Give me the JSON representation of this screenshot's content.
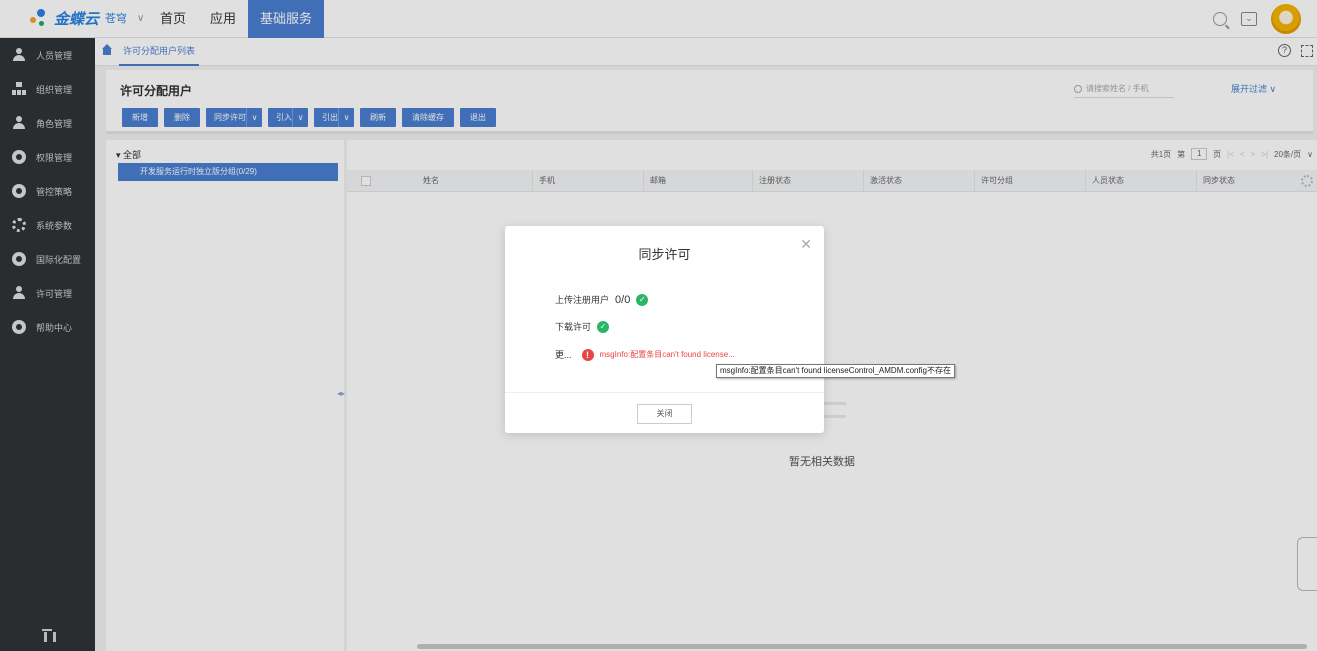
{
  "header": {
    "logo_text": "金蝶云",
    "logo_sub": "苍穹",
    "nav": [
      "首页",
      "应用",
      "基础服务"
    ],
    "active_nav": "基础服务"
  },
  "sidebar": {
    "items": [
      {
        "label": "人员管理",
        "icon": "person-icon"
      },
      {
        "label": "组织管理",
        "icon": "org-icon"
      },
      {
        "label": "角色管理",
        "icon": "role-icon"
      },
      {
        "label": "权限管理",
        "icon": "shield-icon"
      },
      {
        "label": "管控策略",
        "icon": "policy-icon"
      },
      {
        "label": "系统参数",
        "icon": "gear-icon"
      },
      {
        "label": "国际化配置",
        "icon": "globe-icon"
      },
      {
        "label": "许可管理",
        "icon": "license-icon"
      },
      {
        "label": "帮助中心",
        "icon": "help-icon"
      }
    ]
  },
  "tabs": {
    "active": "许可分配用户列表"
  },
  "page": {
    "title": "许可分配用户",
    "search_placeholder": "请搜索姓名 / 手机",
    "expand_filter": "展开过滤 ∨",
    "toolbar": {
      "new": "新增",
      "delete": "删除",
      "sync_license": "同步许可",
      "import": "引入",
      "export": "引出",
      "refresh": "刷新",
      "clear_cache": "清除缓存",
      "exit": "退出"
    }
  },
  "tree": {
    "root": "全部",
    "selected_node": "开发服务运行时独立版分组(0/29)"
  },
  "pager": {
    "total_pages": "共1页",
    "page_prefix": "第",
    "page_value": "1",
    "page_suffix": "页",
    "page_size": "20条/页"
  },
  "grid": {
    "columns": [
      "姓名",
      "手机",
      "邮箱",
      "注册状态",
      "激活状态",
      "许可分组",
      "人员状态",
      "同步状态"
    ],
    "empty_text": "暂无相关数据"
  },
  "modal": {
    "title": "同步许可",
    "upload_label": "上传注册用户",
    "upload_value": "0/0",
    "download_label": "下载许可",
    "more_label": "更...",
    "error_text": "msgInfo:配置条目can't found license...",
    "close_button": "关闭"
  },
  "tooltip": {
    "text": "msgInfo:配置条目can't found licenseControl_AMDM.config不存在"
  },
  "colors": {
    "accent": "#4a7fd1",
    "sidebar_bg": "#2f3437",
    "success": "#2bb566",
    "error": "#e84545"
  }
}
